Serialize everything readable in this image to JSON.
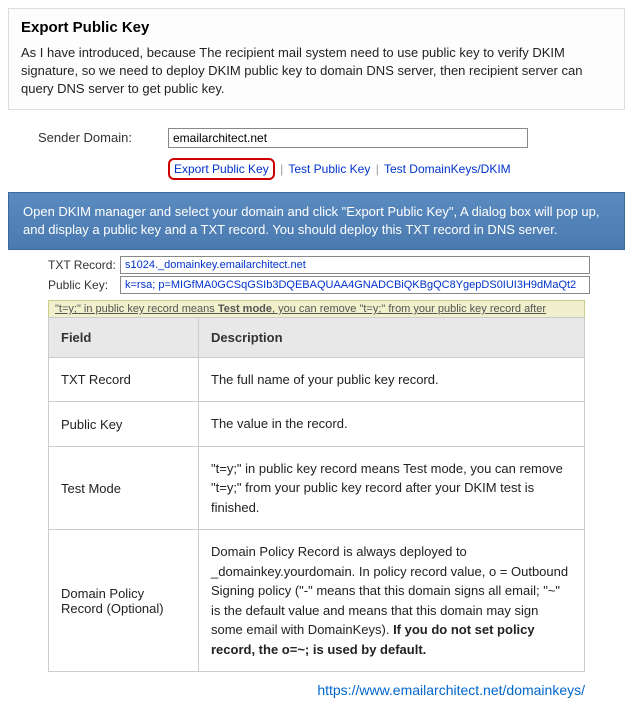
{
  "intro": {
    "title": "Export Public Key",
    "body": "As I have introduced, because The recipient mail system need to use public key to verify DKIM signature, so we need to deploy DKIM public key to domain DNS server, then recipient server can query DNS server to get public key."
  },
  "form": {
    "sender_label": "Sender Domain:",
    "sender_value": "emailarchitect.net"
  },
  "links": {
    "export": "Export Public Key",
    "test_pk": "Test Public Key",
    "test_dk": "Test DomainKeys/DKIM"
  },
  "callout": "Open DKIM manager and select your domain and click \"Export Public Key\", A dialog box will pop up, and display a public key and a TXT record. You should deploy this TXT record in DNS server.",
  "kv": {
    "txt_label": "TXT Record:",
    "txt_value": "s1024._domainkey.emailarchitect.net",
    "pk_label": "Public Key:",
    "pk_value": "k=rsa; p=MIGfMA0GCSqGSIb3DQEBAQUAA4GNADCBiQKBgQC8YgepDS0IUI3H9dMaQt2"
  },
  "note": {
    "pre": "\"t=y;\" in public key record means ",
    "bold": "Test mode",
    "post": ", you can remove \"t=y;\" from your public key record after"
  },
  "table": {
    "h_field": "Field",
    "h_desc": "Description",
    "rows": [
      {
        "field": "TXT Record",
        "desc": "The full name of your public key record."
      },
      {
        "field": "Public Key",
        "desc": "The value in the record."
      },
      {
        "field": "Test Mode",
        "desc": "\"t=y;\" in public key record means Test mode, you can remove \"t=y;\" from your public key record after your DKIM test is finished."
      },
      {
        "field": "Domain Policy Record (Optional)",
        "desc_pre": "Domain Policy Record is always deployed to _domainkey.yourdomain. In policy record value, o = Outbound Signing policy (\"-\" means that this domain signs all email; \"~\" is the default value and means that this domain may sign some email with DomainKeys). ",
        "desc_bold": "If you do not set policy record, the o=~; is used by default."
      }
    ]
  },
  "footer_url": "https://www.emailarchitect.net/domainkeys/"
}
